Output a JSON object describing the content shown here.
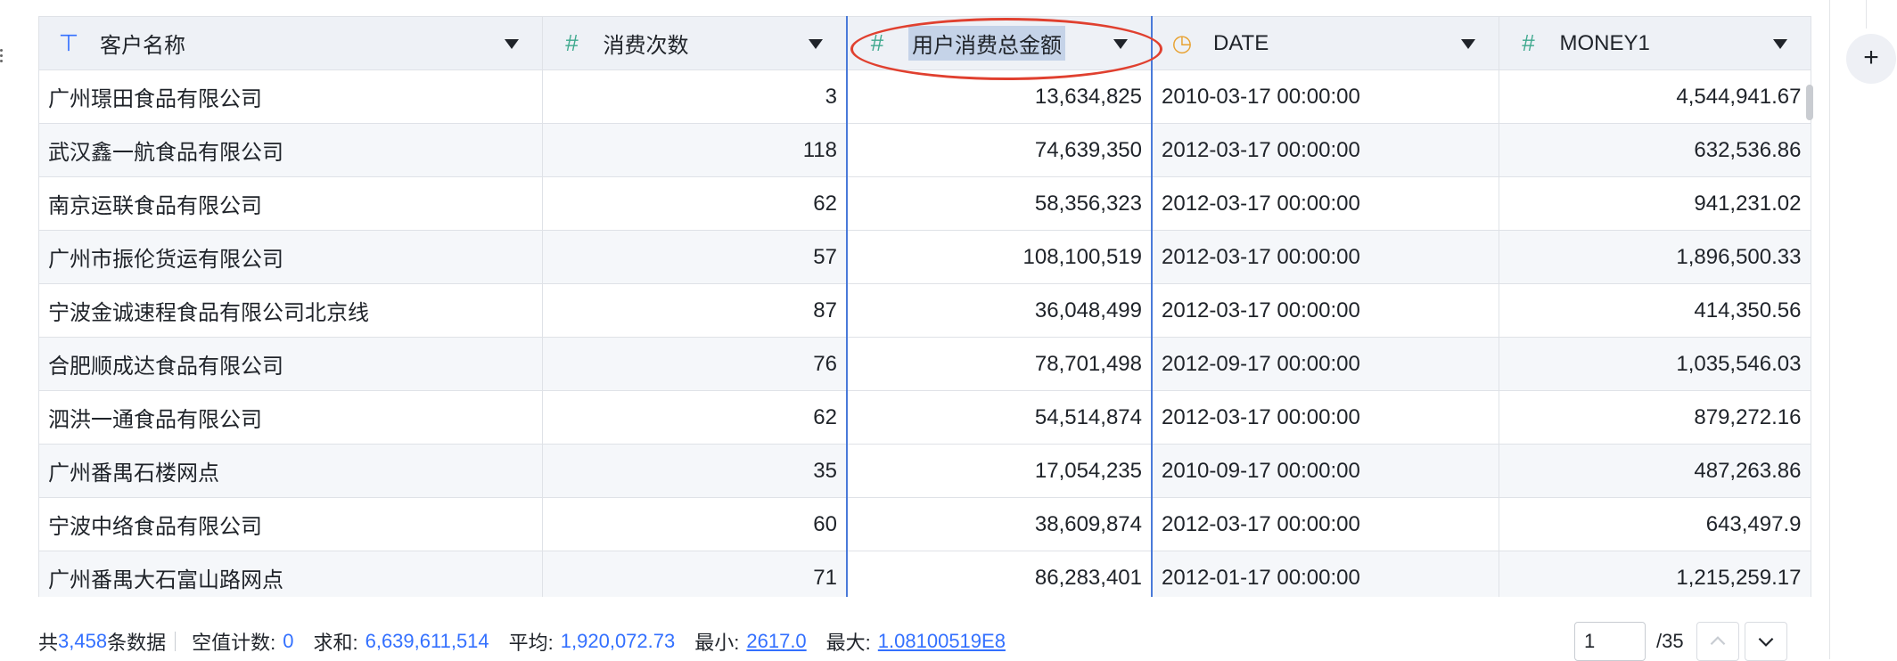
{
  "table": {
    "columns": [
      {
        "label": "客户名称",
        "type_icon": "text-type-icon",
        "type_glyph": "⊤"
      },
      {
        "label": "消费次数",
        "type_icon": "number-type-icon",
        "type_glyph": "#"
      },
      {
        "label": "用户消费总金额",
        "type_icon": "number-type-icon",
        "type_glyph": "#"
      },
      {
        "label": "DATE",
        "type_icon": "date-type-icon",
        "type_glyph": "◷"
      },
      {
        "label": "MONEY1",
        "type_icon": "number-type-icon",
        "type_glyph": "#"
      }
    ],
    "selected_column": "用户消费总金额",
    "rows": [
      [
        "广州璟田食品有限公司",
        "3",
        "13,634,825",
        "2010-03-17 00:00:00",
        "4,544,941.67"
      ],
      [
        "武汉鑫一航食品有限公司",
        "118",
        "74,639,350",
        "2012-03-17 00:00:00",
        "632,536.86"
      ],
      [
        "南京运联食品有限公司",
        "62",
        "58,356,323",
        "2012-03-17 00:00:00",
        "941,231.02"
      ],
      [
        "广州市振伦货运有限公司",
        "57",
        "108,100,519",
        "2012-03-17 00:00:00",
        "1,896,500.33"
      ],
      [
        "宁波金诚速程食品有限公司北京线",
        "87",
        "36,048,499",
        "2012-03-17 00:00:00",
        "414,350.56"
      ],
      [
        "合肥顺成达食品有限公司",
        "76",
        "78,701,498",
        "2012-09-17 00:00:00",
        "1,035,546.03"
      ],
      [
        "泗洪一通食品有限公司",
        "62",
        "54,514,874",
        "2012-03-17 00:00:00",
        "879,272.16"
      ],
      [
        "广州番禺石楼网点",
        "35",
        "17,054,235",
        "2010-09-17 00:00:00",
        "487,263.86"
      ],
      [
        "宁波中络食品有限公司",
        "60",
        "38,609,874",
        "2012-03-17 00:00:00",
        "643,497.9"
      ],
      [
        "广州番禺大石富山路网点",
        "71",
        "86,283,401",
        "2012-01-17 00:00:00",
        "1,215,259.17"
      ]
    ]
  },
  "footer": {
    "total_prefix": "共",
    "total_count": "3,458",
    "total_suffix": "条数据",
    "null_label": "空值计数:",
    "null_value": "0",
    "sum_label": "求和:",
    "sum_value": "6,639,611,514",
    "avg_label": "平均:",
    "avg_value": "1,920,072.73",
    "min_label": "最小:",
    "min_value": "2617.0",
    "max_label": "最大:",
    "max_value": "1.08100519E8"
  },
  "pager": {
    "current_page": "1",
    "total_pages": "/35"
  },
  "add_column_label": "+",
  "colors": {
    "accent": "#3370ff",
    "number_icon": "#3fa98e",
    "date_icon": "#e8a232",
    "selection_border": "#4a7ad9",
    "annotation": "#e0402f"
  }
}
